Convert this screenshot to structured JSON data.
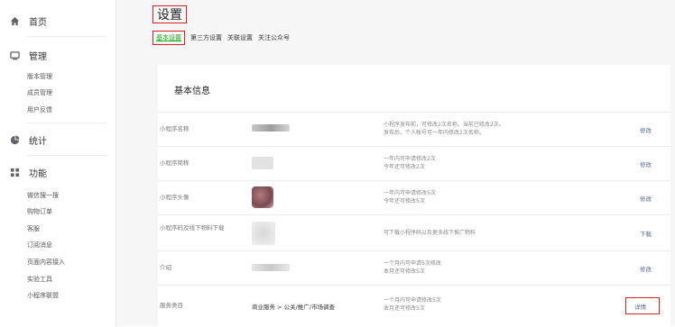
{
  "sidebar": {
    "home": "首页",
    "manage": {
      "label": "管理",
      "items": [
        "版本管理",
        "成员管理",
        "用户反馈"
      ]
    },
    "stats": "统计",
    "features": {
      "label": "功能",
      "items": [
        "微信搜一搜",
        "购物订单",
        "客服",
        "订阅消息",
        "页面内容接入",
        "实验工具",
        "小程序联盟"
      ]
    }
  },
  "main": {
    "title": "设置",
    "tabs": [
      "基本设置",
      "第三方设置",
      "关联设置",
      "关注公众号"
    ],
    "section_title": "基本信息",
    "rows": [
      {
        "label": "小程序名称",
        "desc1": "小程序发布前，可修改2次名称。当前已修改2次。",
        "desc2": "发布后，个人帐号可一年内修改2次名称。",
        "action": "修改"
      },
      {
        "label": "小程序简称",
        "desc1": "一年内可申请修改2次",
        "desc2": "今年还可修改2次",
        "action": "修改"
      },
      {
        "label": "小程序头像",
        "desc1": "一年内可申请修改5次",
        "desc2": "今年还可修改5次",
        "action": "修改"
      },
      {
        "label": "小程序码及线下物料下载",
        "desc1": "可下载小程序码以及更多线下推广物料",
        "desc2": "",
        "action": "下载"
      },
      {
        "label": "介绍",
        "desc1": "一个月内可申请5次修改",
        "desc2": "本月还可修改5次",
        "action": "修改"
      },
      {
        "label": "服务类目",
        "value": "商业服务 > 公关/推广/市场调查",
        "desc1": "一个月内可申请修改5次",
        "desc2": "本月还可修改5次",
        "action": "详情"
      }
    ]
  },
  "colors": {
    "accent": "#1aad19",
    "link": "#576b95",
    "highlight": "#e02020"
  }
}
